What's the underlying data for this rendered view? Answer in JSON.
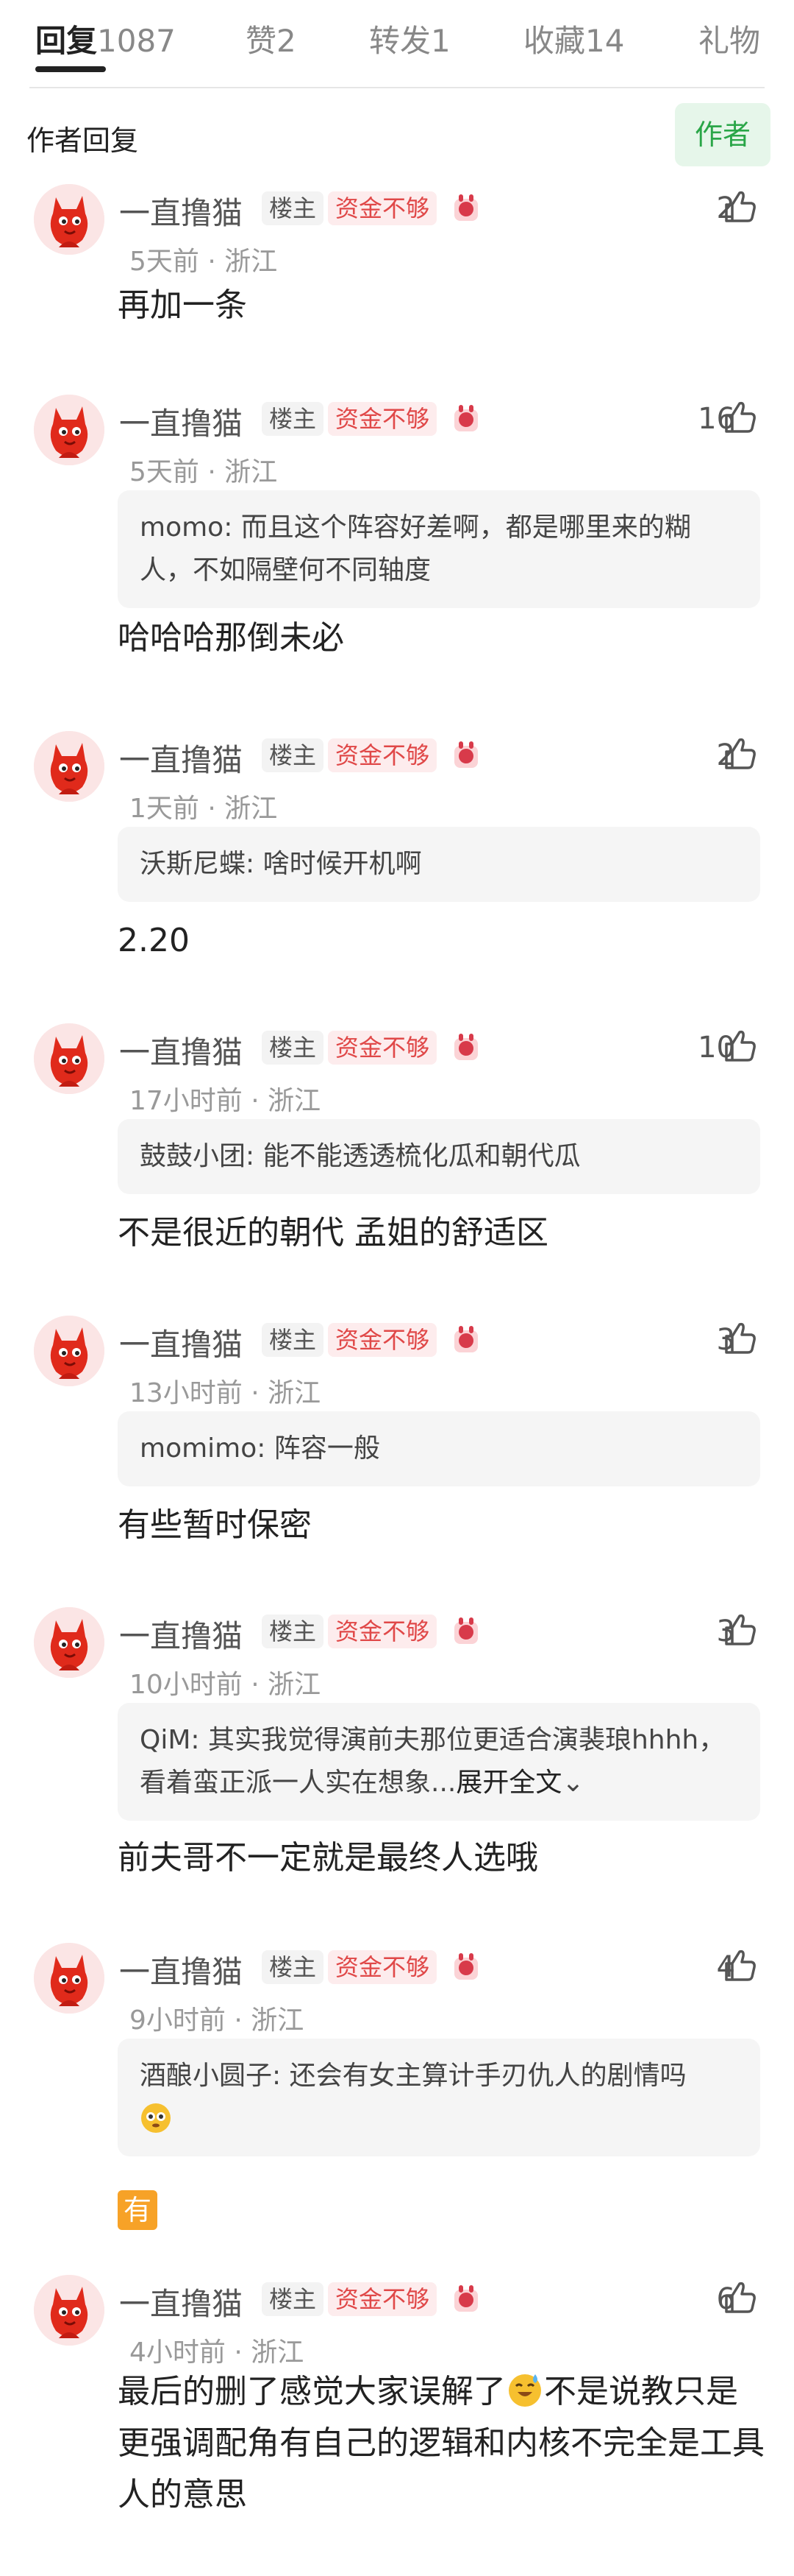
{
  "tabs": [
    {
      "label": "回复",
      "count": "1087"
    },
    {
      "label": "赞",
      "count": "2"
    },
    {
      "label": "转发",
      "count": "1"
    },
    {
      "label": "收藏",
      "count": "14"
    },
    {
      "label": "礼物",
      "count": ""
    }
  ],
  "section": {
    "title": "作者回复",
    "author_pill": "作者"
  },
  "author": {
    "name": "一直撸猫",
    "host_tag": "楼主",
    "fund_tag": "资金不够"
  },
  "comments": [
    {
      "likes": "2",
      "time": "5天前",
      "location": "浙江",
      "quote_user": "",
      "quote_text": "",
      "body": "再加一条"
    },
    {
      "likes": "16",
      "time": "5天前",
      "location": "浙江",
      "quote_user": "momo",
      "quote_text": "而且这个阵容好差啊，都是哪里来的糊人，不如隔壁何不同轴度",
      "body": "哈哈哈那倒未必"
    },
    {
      "likes": "2",
      "time": "1天前",
      "location": "浙江",
      "quote_user": "沃斯尼蝶",
      "quote_text": "啥时候开机啊",
      "body": "2.20"
    },
    {
      "likes": "10",
      "time": "17小时前",
      "location": "浙江",
      "quote_user": "鼓鼓小团",
      "quote_text": "能不能透透梳化瓜和朝代瓜",
      "body": "不是很近的朝代 孟姐的舒适区"
    },
    {
      "likes": "3",
      "time": "13小时前",
      "location": "浙江",
      "quote_user": "momimo",
      "quote_text": "阵容一般",
      "body": "有些暂时保密"
    },
    {
      "likes": "3",
      "time": "10小时前",
      "location": "浙江",
      "quote_user": "QiM",
      "quote_text": "其实我觉得演前夫那位更适合演裴琅hhhh，看着蛮正派一人实在想象...",
      "quote_expand": "展开全文",
      "body": "前夫哥不一定就是最终人选哦"
    },
    {
      "likes": "4",
      "time": "9小时前",
      "location": "浙江",
      "quote_user": "酒酿小圆子",
      "quote_text": "还会有女主算计手刃仇人的剧情吗",
      "body_emoji": "有"
    },
    {
      "likes": "6",
      "time": "4小时前",
      "location": "浙江",
      "quote_user": "",
      "quote_text": "",
      "body_part1": "最后的删了感觉大家误解了",
      "body_part2": "不是说教只是更强调配角有自己的逻辑和内核不完全是工具人的意思"
    }
  ],
  "colors": {
    "accent_green": "#2aa648",
    "fund_red": "#e04848"
  },
  "icons": {
    "like": "thumbs-up-icon",
    "avatar": "red-cartoon-avatar",
    "badge": "fan-badge-icon"
  }
}
